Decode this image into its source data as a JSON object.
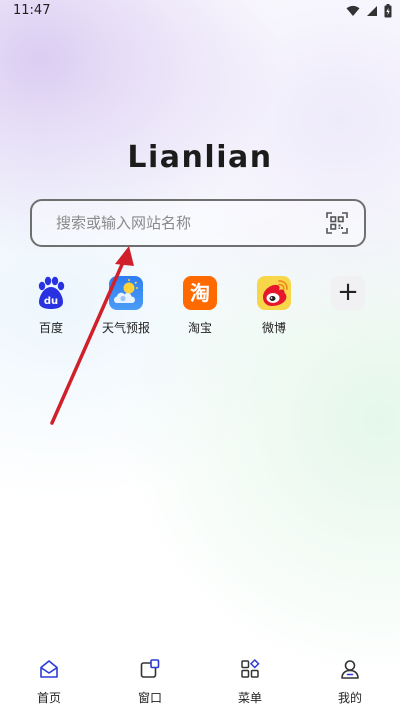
{
  "status_bar": {
    "time": "11:47",
    "icons": [
      "wifi-icon",
      "signal-icon",
      "battery-icon"
    ]
  },
  "logo": {
    "text": "Lianlian"
  },
  "search": {
    "placeholder": "搜索或输入网站名称",
    "value": "",
    "scan_icon": "qr-scan-icon"
  },
  "shortcuts": [
    {
      "label": "百度",
      "icon": "baidu-icon"
    },
    {
      "label": "天气预报",
      "icon": "weather-icon"
    },
    {
      "label": "淘宝",
      "icon": "taobao-icon",
      "glyph": "淘"
    },
    {
      "label": "微博",
      "icon": "weibo-icon"
    },
    {
      "label": "",
      "icon": "add-icon",
      "glyph": "+"
    }
  ],
  "bottom_nav": [
    {
      "label": "首页",
      "icon": "home-icon"
    },
    {
      "label": "窗口",
      "icon": "window-icon"
    },
    {
      "label": "菜单",
      "icon": "menu-icon"
    },
    {
      "label": "我的",
      "icon": "profile-icon"
    }
  ],
  "colors": {
    "annotation_arrow": "#d0202a",
    "taobao": "#ff6a00",
    "weather": "#2e7df2",
    "weibo_bg": "#f7d64a",
    "baidu": "#2932e1"
  }
}
